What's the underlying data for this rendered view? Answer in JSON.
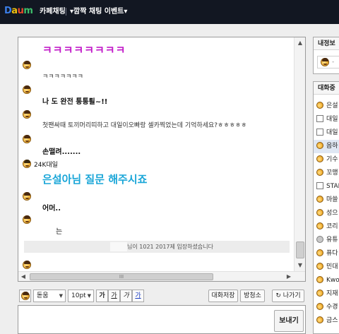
{
  "header": {
    "logo_d": "D",
    "logo_a": "a",
    "logo_u": "u",
    "logo_m": "m",
    "cafe_chat": "카페채팅",
    "event": "▾깜짝 채팅 이벤트▾"
  },
  "chat": {
    "messages": [
      "ㅋㅋㅋㅋㅋㅋㅋㅋ",
      "ㅋㅋㅋㅋㅋㅋㅋ",
      "나 도 완전 통통퇼~!!",
      "첫팬싸때 토끼머리띠하고 대일이오빠랑 셀카찍었는데 기억하세요?ㅎㅎㅎㅎㅎ",
      "손떨려.......",
      "은설아님 질문 해주시죠",
      "어머..",
      "는"
    ],
    "nickname_24k": "24K대일",
    "system_notice": "님이 1021 2017제 입장하셨습니다",
    "hscroll_grip": "III"
  },
  "toolbar": {
    "font": "돋움",
    "size": "10pt",
    "bold": "가",
    "underline": "가",
    "italic": "가",
    "color": "가",
    "save_chat": "대화저장",
    "leave_room": "방청소",
    "exit": "나가기"
  },
  "input": {
    "value": "",
    "send": "보내기"
  },
  "sidebar": {
    "my_info_title": "내정보",
    "my_info_dash": "-",
    "members_title": "대화중",
    "members": [
      {
        "name": "은설",
        "icon": "face"
      },
      {
        "name": "대일",
        "icon": "box"
      },
      {
        "name": "대일",
        "icon": "box"
      },
      {
        "name": "음하",
        "icon": "face"
      },
      {
        "name": "기수",
        "icon": "face"
      },
      {
        "name": "꼬맹",
        "icon": "face"
      },
      {
        "name": "STAI",
        "icon": "box"
      },
      {
        "name": "마쓸",
        "icon": "face"
      },
      {
        "name": "성으",
        "icon": "face"
      },
      {
        "name": "코리",
        "icon": "face"
      },
      {
        "name": "유튜",
        "icon": "gray"
      },
      {
        "name": "퓨다",
        "icon": "face"
      },
      {
        "name": "민대",
        "icon": "face"
      },
      {
        "name": "Kwo",
        "icon": "face"
      },
      {
        "name": "지재",
        "icon": "face"
      },
      {
        "name": "수경",
        "icon": "face"
      },
      {
        "name": "금스",
        "icon": "face"
      }
    ]
  },
  "colors": {
    "topbar": "#121722",
    "laugh_purple": "#c21cc9",
    "question_blue": "#1aa6d8"
  }
}
